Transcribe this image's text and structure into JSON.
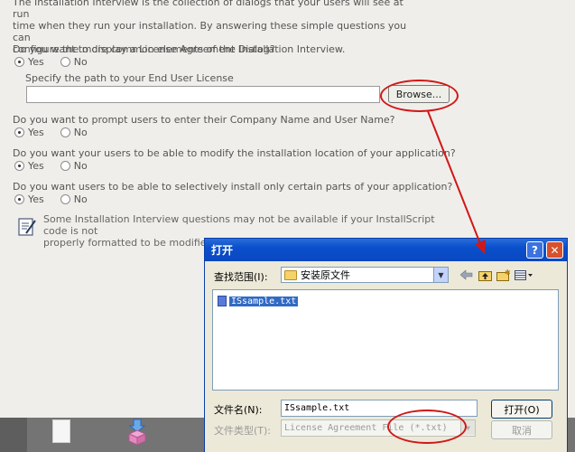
{
  "intro": {
    "line1": "The Installation Interview is the collection of dialogs that your users will see at run",
    "line2": "time when they run your installation. By answering these simple questions you can",
    "line3": "configure the more common elements of the Installation Interview."
  },
  "questions": [
    {
      "text": "Do you want to display a License Agreement Dialog?",
      "yes": "Yes",
      "no": "No",
      "selected": "yes"
    },
    {
      "text": "Do you want to prompt users to enter their Company Name and User Name?",
      "yes": "Yes",
      "no": "No",
      "selected": "yes"
    },
    {
      "text": "Do you want your users to be able to modify the installation location of your application?",
      "yes": "Yes",
      "no": "No",
      "selected": "yes"
    },
    {
      "text": "Do you want users to be able to selectively install only certain parts of your application?",
      "yes": "Yes",
      "no": "No",
      "selected": "yes"
    }
  ],
  "license_path": {
    "label": "Specify the path to your End User License",
    "value": "",
    "browse_label": "Browse..."
  },
  "note": {
    "line1": "Some Installation Interview questions may not be available if your InstallScript code is not",
    "line2": "properly formatted to be modified by the Project Assistant."
  },
  "dialog": {
    "title": "打开",
    "help_glyph": "?",
    "close_glyph": "✕",
    "lookin_label": "查找范围(I):",
    "lookin_value": "安装原文件",
    "files": [
      "ISsample.txt"
    ],
    "filename_label": "文件名(N):",
    "filename_value": "ISsample.txt",
    "filetype_label": "文件类型(T):",
    "filetype_value": "License Agreement File (*.txt)",
    "open_label": "打开(O)",
    "cancel_label": "取消"
  },
  "colors": {
    "annotation": "#d01818",
    "titlebar": "#0a4fcc",
    "selection": "#316ac5"
  },
  "icons": [
    "note-icon",
    "folder-icon",
    "back-arrow-icon",
    "up-folder-icon",
    "new-folder-icon",
    "view-menu-icon",
    "text-file-icon",
    "document-icon",
    "package-icon"
  ]
}
